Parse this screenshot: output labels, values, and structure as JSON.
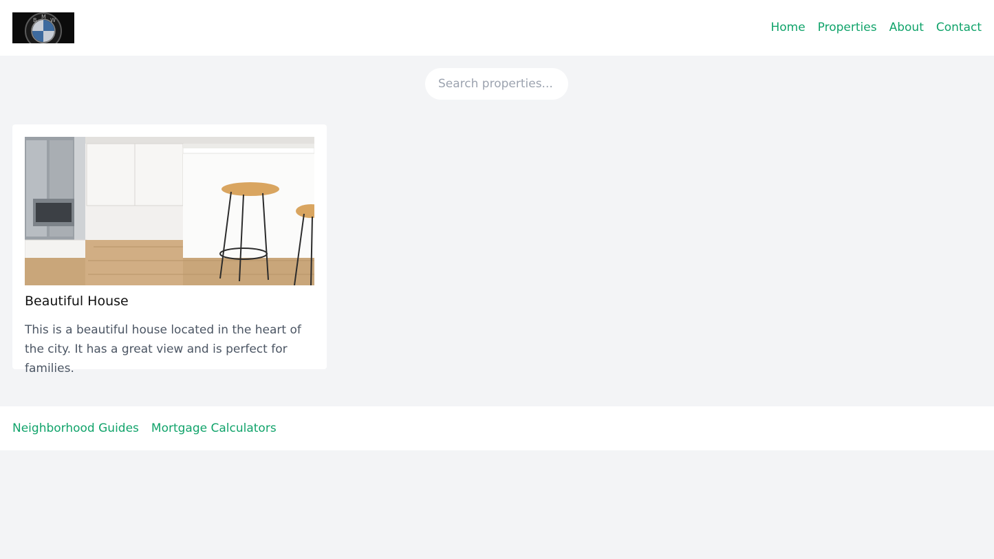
{
  "header": {
    "logo_letters": "BMW",
    "nav": [
      "Home",
      "Properties",
      "About",
      "Contact"
    ]
  },
  "search": {
    "placeholder": "Search properties..."
  },
  "listings": [
    {
      "title": "Beautiful House",
      "description": "This is a beautiful house located in the heart of the city. It has a great view and is perfect for families."
    }
  ],
  "footer": {
    "links": [
      "Neighborhood Guides",
      "Mortgage Calculators"
    ]
  },
  "colors": {
    "accent": "#10a36a",
    "page_background": "#f3f4f6",
    "surface": "#ffffff"
  }
}
